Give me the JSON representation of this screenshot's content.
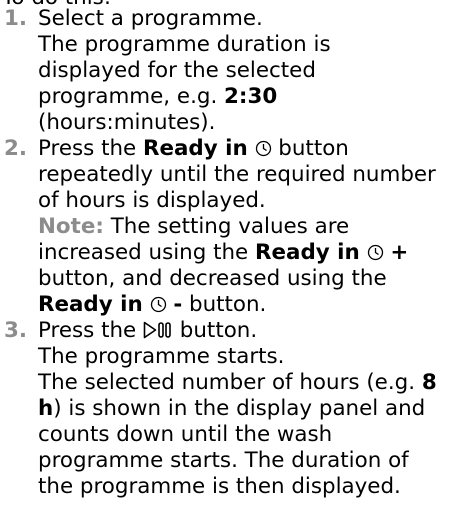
{
  "intro": "To do this:",
  "steps": [
    {
      "number": "1.",
      "text": "Select a programme.",
      "body_1": "The programme duration is",
      "body_2": "displayed for the selected",
      "body_3": "programme, e.g. ",
      "example_value": "2:30",
      "body_4": "(hours:minutes)."
    },
    {
      "number": "2.",
      "text_a": "Press the ",
      "button_name": "Ready in",
      "text_b": " button",
      "body_1": "repeatedly until the required number",
      "body_2": "of hours is displayed.",
      "note_label": "Note:",
      "note_1": " The setting values are",
      "note_2": "increased using the ",
      "plus_button": "Ready in",
      "plus_sign": "+",
      "note_3": "button, and decreased using the",
      "minus_button": "Ready in",
      "minus_sign": "-",
      "note_4": " button."
    },
    {
      "number": "3.",
      "text_a": "Press the ",
      "text_b": " button.",
      "body_1": "The programme starts.",
      "body_2a": "The selected number of hours (e.g. ",
      "example_a": "8",
      "example_b": "h",
      "body_2b": ") is shown in the display panel and",
      "body_3": "counts down until the wash",
      "body_4": "programme starts. The duration of",
      "body_5": "the programme is then displayed."
    }
  ],
  "icons": {
    "clock": "clock-icon",
    "start_pause": "start-pause-icon"
  }
}
